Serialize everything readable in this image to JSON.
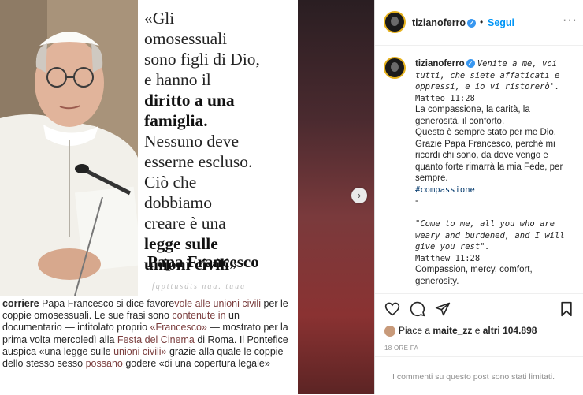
{
  "post": {
    "quote_lines": [
      "«Gli",
      "omosessuali",
      "sono figli di Dio,",
      "e hanno il"
    ],
    "quote_bold_1": [
      "diritto a una",
      "famiglia."
    ],
    "quote_lines_2": [
      "Nessuno deve",
      "esserne escluso.",
      "Ciò che",
      "dobbiamo",
      "creare è una"
    ],
    "quote_bold_2": [
      "legge sulle",
      "unioni civili"
    ],
    "quote_end": "»",
    "signature": "Papa Francesco",
    "watermark": "fqpttusdts naa. tuua"
  },
  "caption": {
    "user": "corriere",
    "parts": [
      {
        "t": " Papa Francesco si dice favore"
      },
      {
        "t": "vole alle unioni civili",
        "hl": true
      },
      {
        "t": " per le coppie omosessuali. Le sue frasi sono "
      },
      {
        "t": "contenute in",
        "hl": true
      },
      {
        "t": " un documentario — intitolato proprio "
      },
      {
        "t": "«Francesco»",
        "hl": true
      },
      {
        "t": " — mostrato per la prima volta mercoledì alla "
      },
      {
        "t": "Festa del Cinema",
        "hl": true
      },
      {
        "t": " di Roma. Il Pontefice auspica «una legge sulle "
      },
      {
        "t": "unioni civili»",
        "hl": true
      },
      {
        "t": " grazie alla quale le coppie dello stesso sesso "
      },
      {
        "t": "possano",
        "hl": true
      },
      {
        "t": " godere «di una copertura legale»"
      }
    ]
  },
  "header": {
    "username": "tizianoferro",
    "verified": "✓",
    "dot": "•",
    "follow_label": "Segui",
    "more": "···"
  },
  "comment": {
    "username": "tizianoferro",
    "line_fancy_it": "Venite a me, voi tutti, che siete affaticati e oppressi, e io vi ristorerò'.",
    "ref_it": "Matteo 11:28",
    "text_it_1": "La compassione, la carità, la generosità, il conforto.",
    "text_it_2": "Questo è sempre stato per me Dio. Grazie Papa Francesco, perché mi ricordi chi sono, da dove vengo e quanto forte rimarrà la mia Fede, per sempre.",
    "hashtag": "#compassione",
    "dash": "-",
    "line_fancy_en": "\"Come to me, all you who are weary and burdened, and I will give you rest\".",
    "ref_en": "Matthew 11:28",
    "text_en": "Compassion, mercy, comfort, generosity."
  },
  "actions": {
    "like_icon": "heart-icon",
    "comment_icon": "comment-icon",
    "share_icon": "paper-plane-icon",
    "save_icon": "bookmark-icon"
  },
  "likes": {
    "prefix": "Piace a ",
    "user": "maite_zz",
    "middle": " e ",
    "others": "altri 104.898"
  },
  "timestamp": "18 ORE FA",
  "comments_limited": "I commenti su questo post sono stati limitati.",
  "nav_arrow": "›",
  "colors": {
    "follow": "#0095f6",
    "verified": "#3897f0",
    "link": "#7a3d3d"
  }
}
